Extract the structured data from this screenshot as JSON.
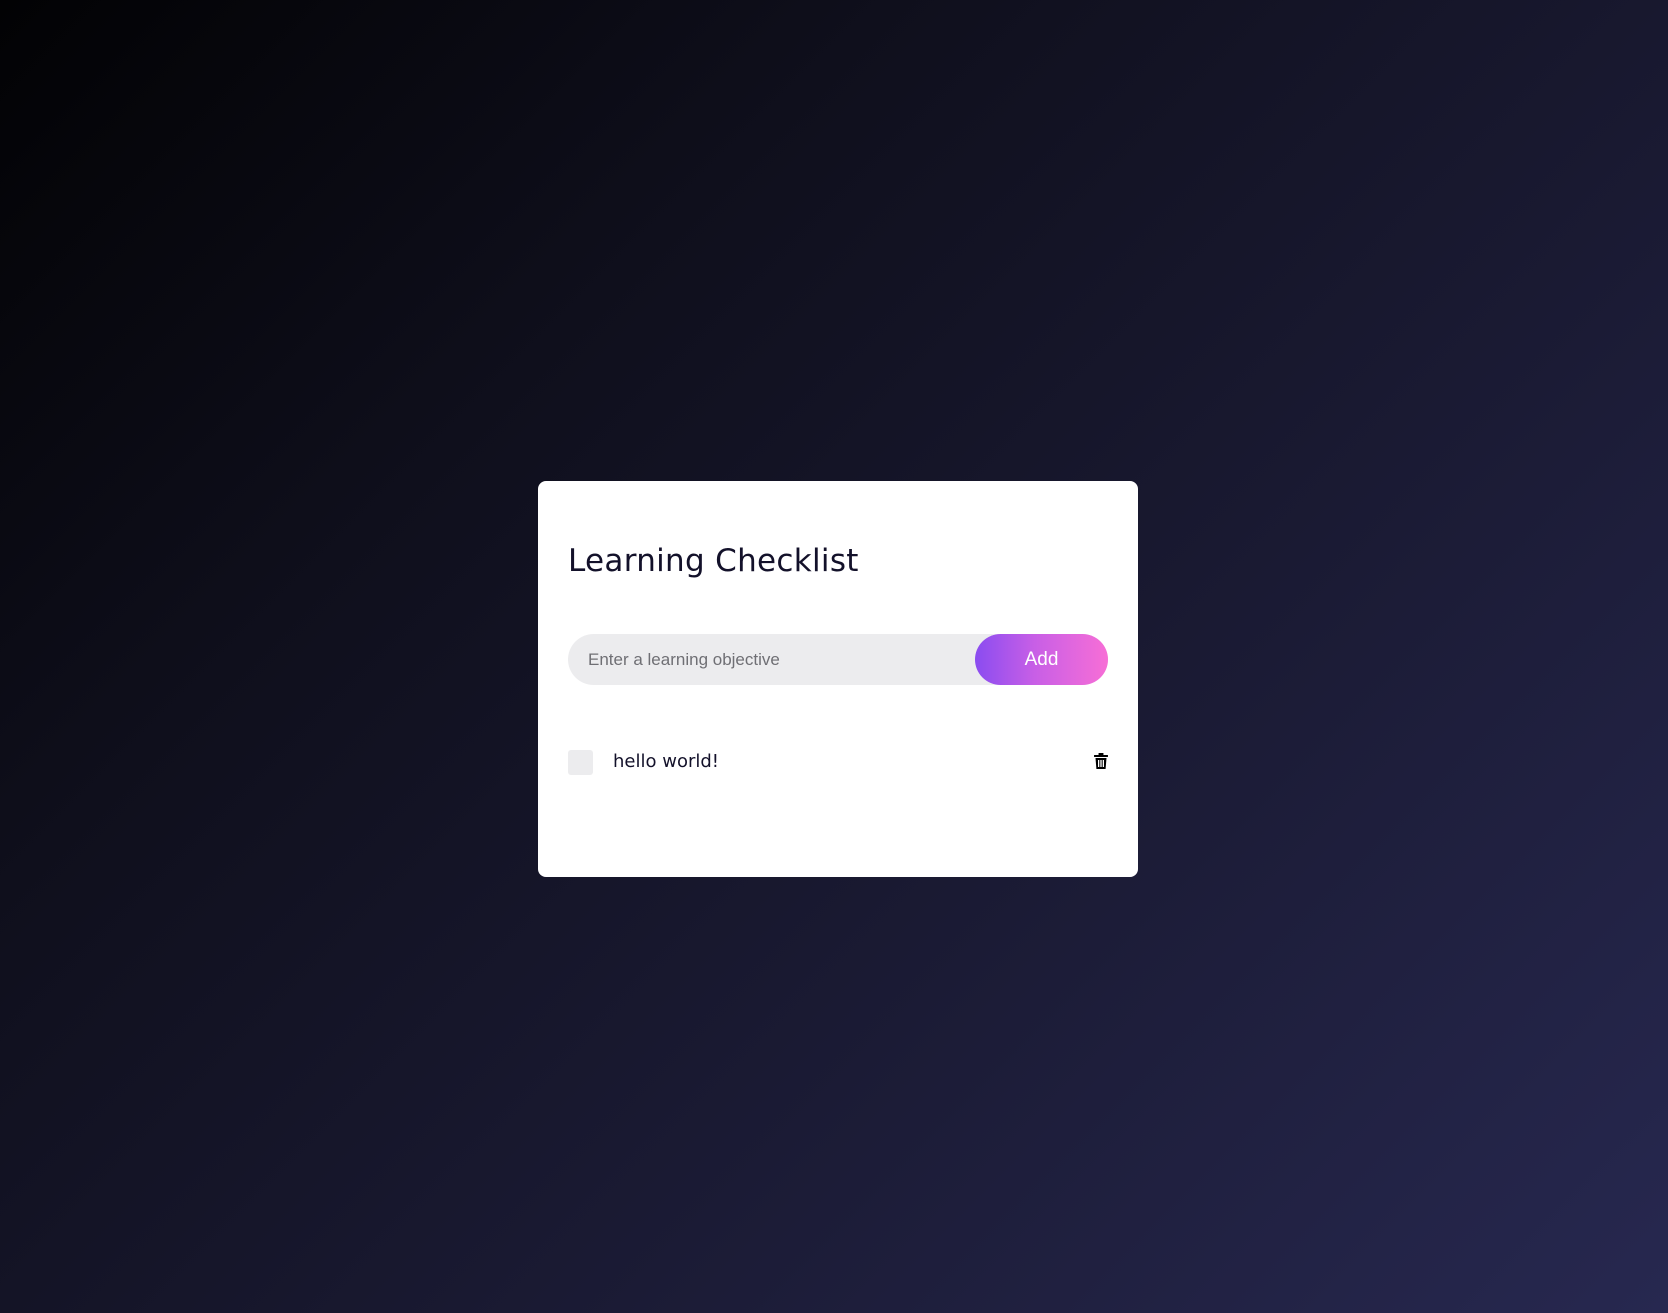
{
  "checklist": {
    "title": "Learning Checklist",
    "input": {
      "placeholder": "Enter a learning objective",
      "value": ""
    },
    "add_label": "Add",
    "items": [
      {
        "label": "hello world!",
        "checked": false,
        "delete_icon": "trash-icon"
      }
    ]
  },
  "colors": {
    "background_start": "#020204",
    "background_end": "#272850",
    "card": "#ffffff",
    "text": "#13112a",
    "input_bg": "#ececee",
    "button_gradient_start": "#8a4cf0",
    "button_gradient_end": "#f76ed6"
  }
}
